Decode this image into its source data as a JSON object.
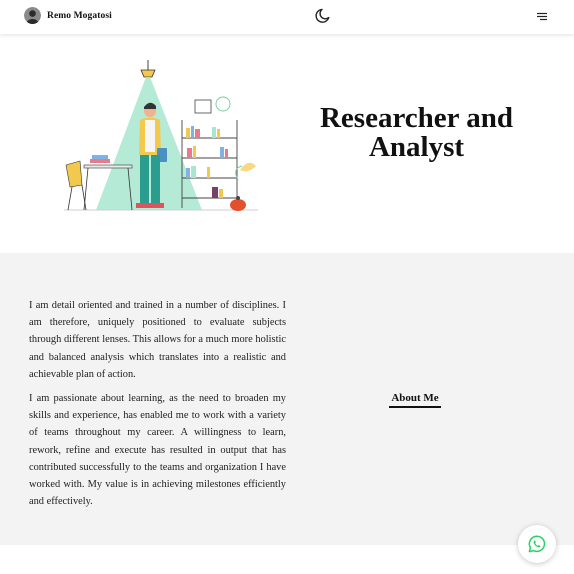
{
  "header": {
    "brand_name": "Remo Mogatosi",
    "avatar_icon": "profile-avatar",
    "theme_toggle_icon": "moon-icon",
    "menu_icon": "menu-icon"
  },
  "hero": {
    "title_line1": "Researcher and",
    "title_line2": "Analyst",
    "illustration": "person-with-books-under-lamp-illustration"
  },
  "about": {
    "heading": "About Me",
    "paragraphs": [
      "I am detail oriented and trained in a number of disciplines. I am therefore, uniquely positioned to evaluate subjects through different lenses. This allows for a much more holistic and balanced analysis which translates into a realistic and achievable plan of action.",
      "I am passionate about learning, as the need to broaden my skills and experience, has enabled me to work with a variety of teams throughout my career. A willingness to learn, rework, refine and execute has resulted in output that has contributed successfully to the teams and organization I have worked with. My value is in achieving milestones efficiently and effectively."
    ]
  },
  "fab": {
    "icon": "whatsapp-icon",
    "color": "#25D366"
  },
  "colors": {
    "section_background": "#f3f3f3",
    "text": "#111111",
    "illustration_accent": "#a8e6cf"
  }
}
